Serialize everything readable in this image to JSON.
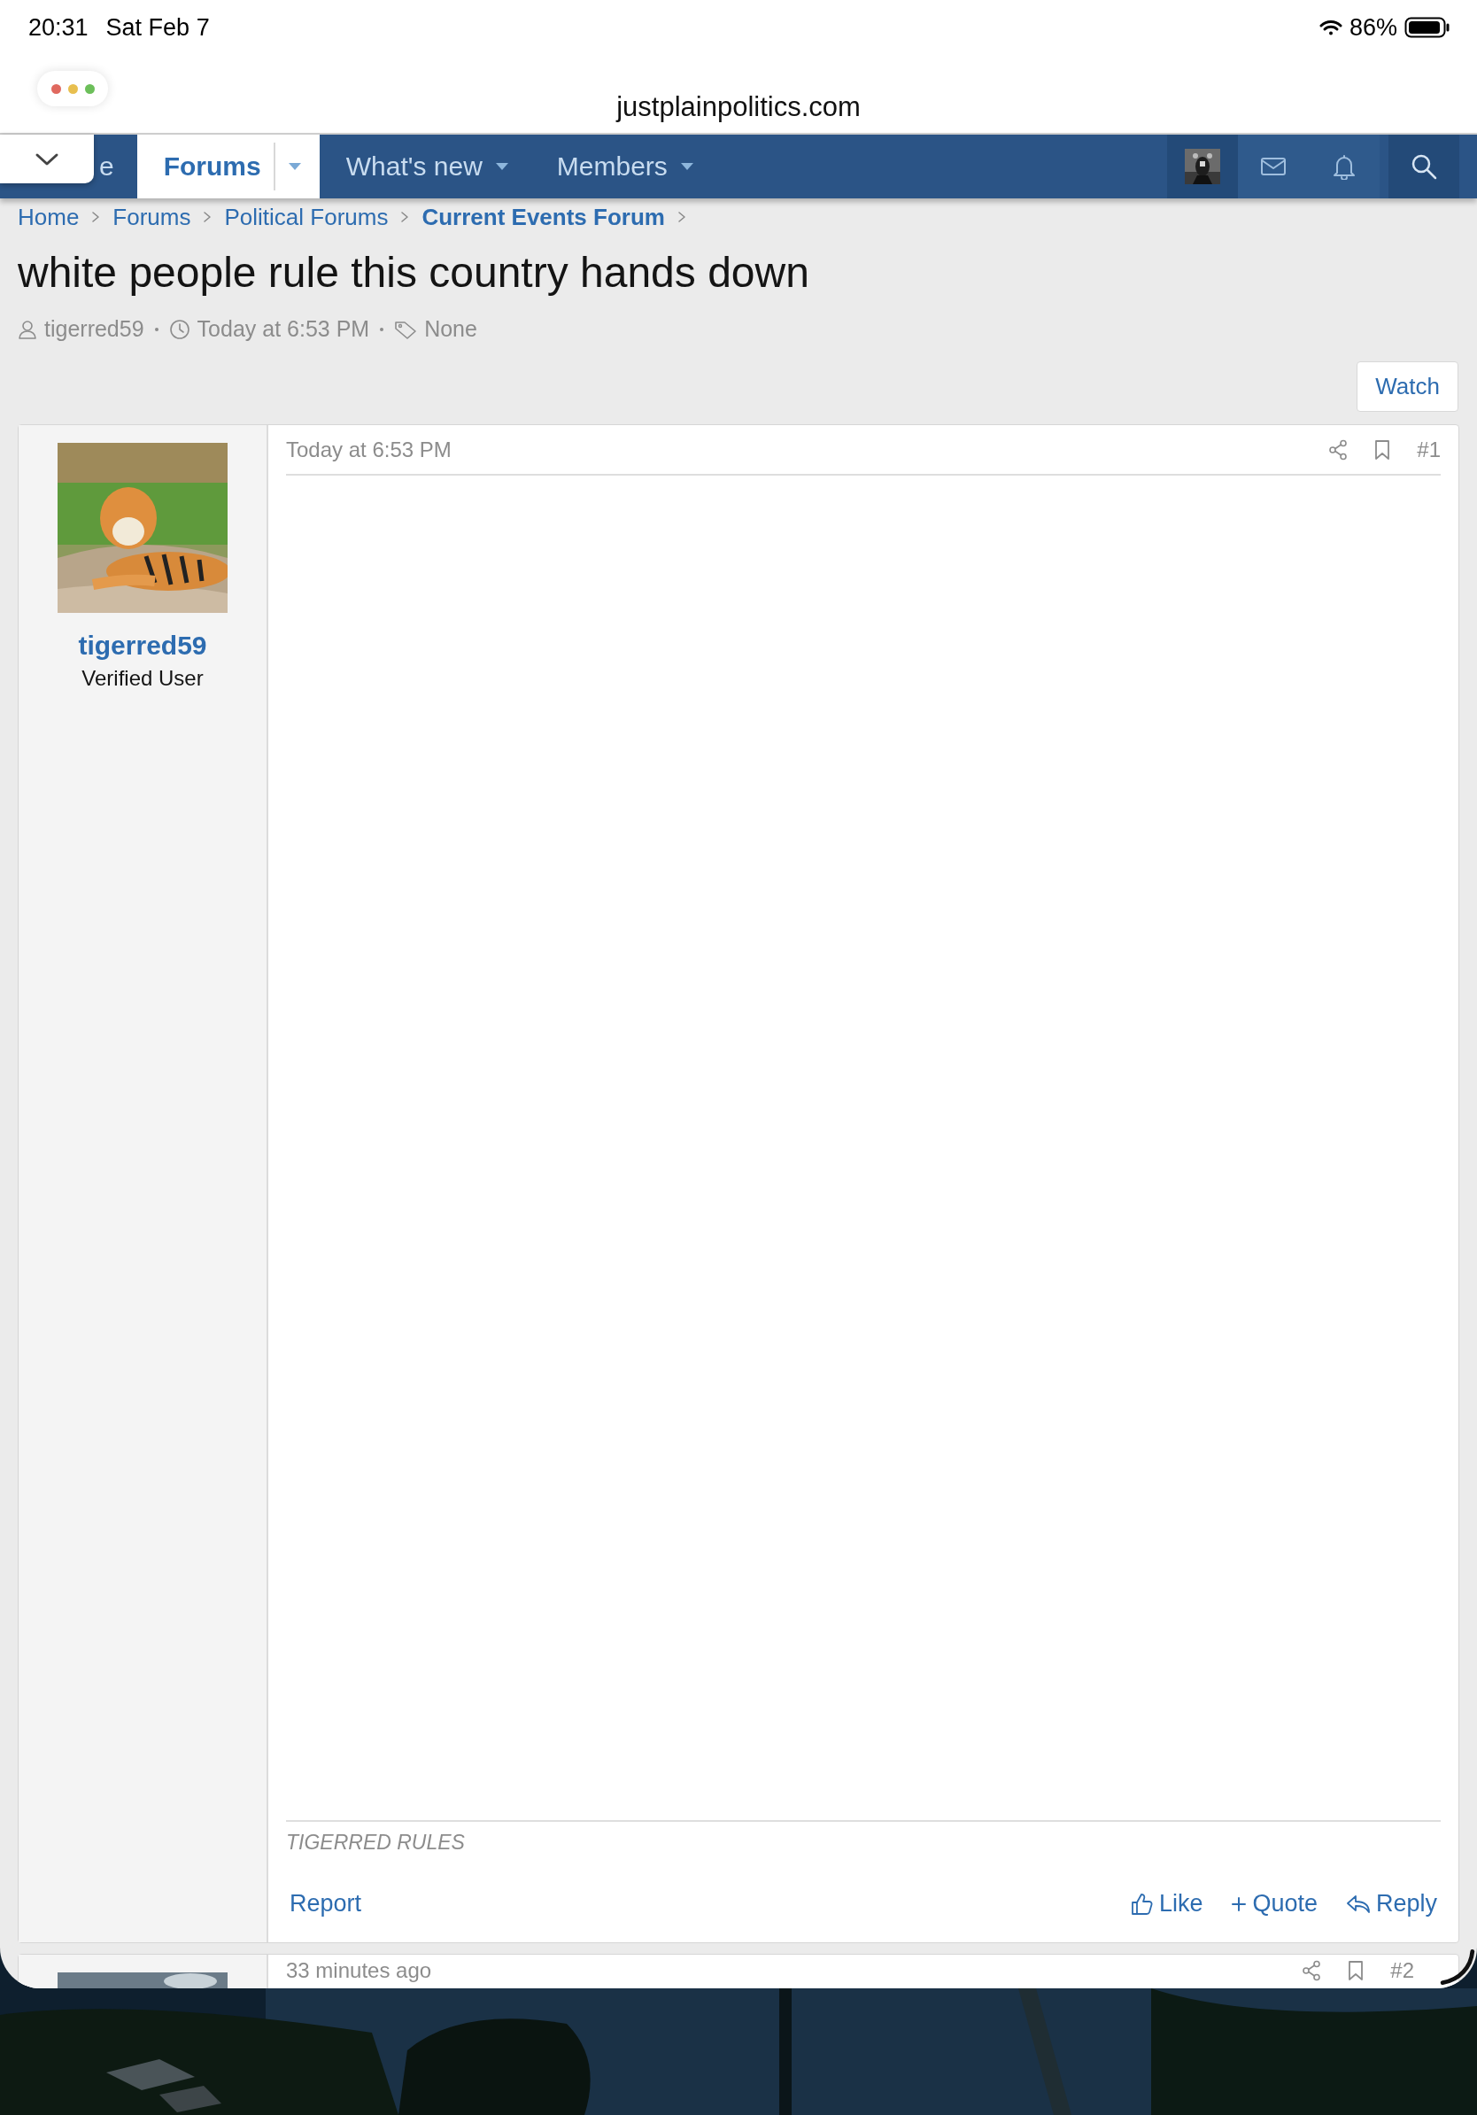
{
  "status_bar": {
    "time": "20:31",
    "date": "Sat Feb 7",
    "battery": "86%"
  },
  "browser": {
    "url": "justplainpolitics.com"
  },
  "nav": {
    "tabs": [
      {
        "label": "e",
        "selected": false,
        "has_menu": false
      },
      {
        "label": "Forums",
        "selected": true,
        "has_menu": true
      },
      {
        "label": "What's new",
        "selected": false,
        "has_menu": true
      },
      {
        "label": "Members",
        "selected": false,
        "has_menu": true
      }
    ]
  },
  "breadcrumbs": [
    {
      "label": "Home",
      "current": false
    },
    {
      "label": "Forums",
      "current": false
    },
    {
      "label": "Political Forums",
      "current": false
    },
    {
      "label": "Current Events Forum",
      "current": true
    }
  ],
  "thread": {
    "title": "white people rule this country hands down",
    "author": "tigerred59",
    "date": "Today at 6:53 PM",
    "tags": "None"
  },
  "watch_button": "Watch",
  "posts": [
    {
      "kind": "full",
      "author": "tigerred59",
      "role": "Verified User",
      "time": "Today at 6:53 PM",
      "number": "#1",
      "signature": "TIGERRED RULES",
      "report": "Report",
      "like": "Like",
      "quote": "Quote",
      "reply": "Reply"
    },
    {
      "kind": "partial",
      "time": "33 minutes ago",
      "number": "#2"
    }
  ]
}
